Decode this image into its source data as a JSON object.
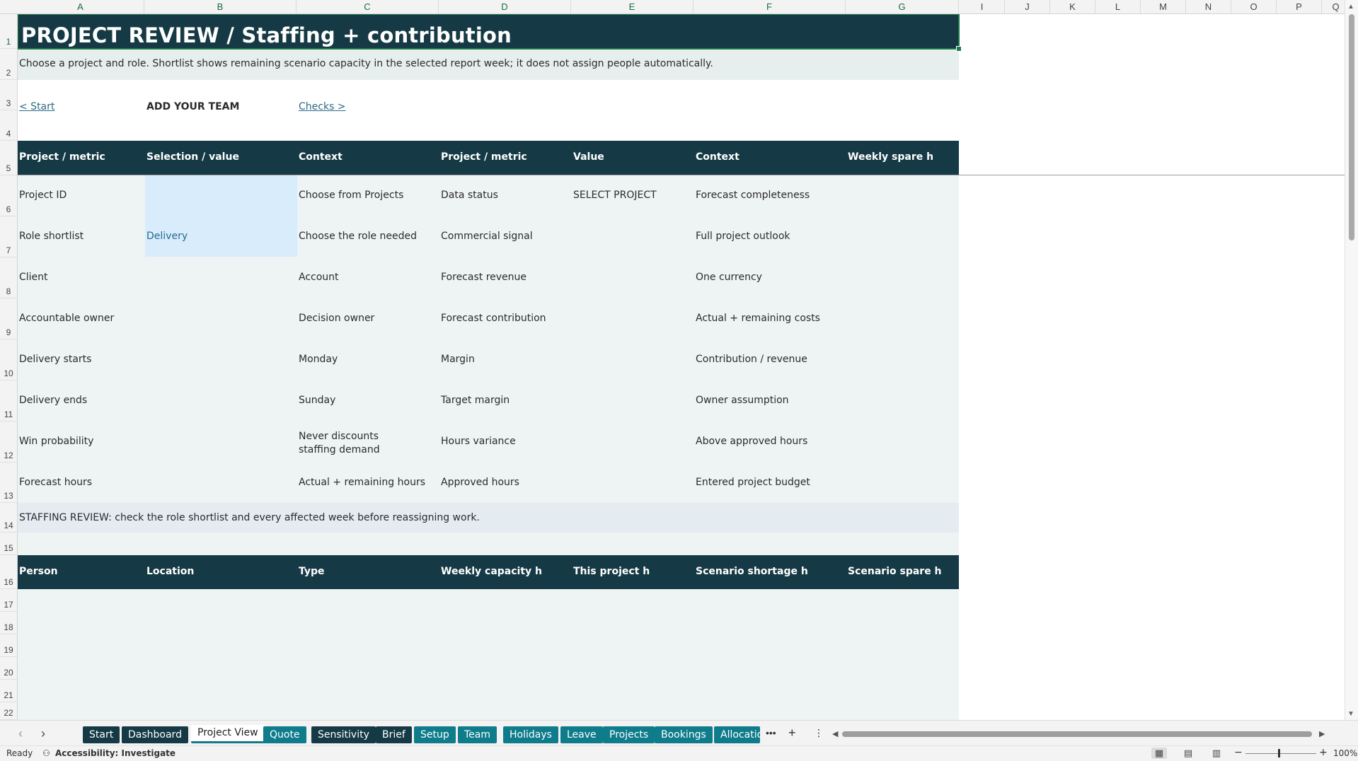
{
  "columns": [
    "A",
    "B",
    "C",
    "D",
    "E",
    "F",
    "G",
    "I",
    "J",
    "K",
    "L",
    "M",
    "N",
    "O",
    "P",
    "Q"
  ],
  "rows": [
    "1",
    "2",
    "3",
    "4",
    "5",
    "6",
    "7",
    "8",
    "9",
    "10",
    "11",
    "12",
    "13",
    "14",
    "15",
    "16",
    "17",
    "18",
    "19",
    "20",
    "21",
    "22"
  ],
  "title": "PROJECT REVIEW / Staffing + contribution",
  "note": "Choose a project and role. Shortlist shows remaining scenario capacity in the selected report week; it does not assign people automatically.",
  "nav": {
    "start": "< Start",
    "add_team": "ADD YOUR TEAM",
    "checks": "Checks >"
  },
  "project_header": [
    "Project / metric",
    "Selection / value",
    "Context",
    "Project / metric",
    "Value",
    "Context",
    "Weekly spare h"
  ],
  "project_rows": [
    [
      "Project ID",
      "",
      "Choose from Projects",
      "Data status",
      "SELECT PROJECT",
      "Forecast completeness"
    ],
    [
      "Role shortlist",
      "Delivery",
      "Choose the role needed",
      "Commercial signal",
      "",
      "Full project outlook"
    ],
    [
      "Client",
      "",
      "Account",
      "Forecast revenue",
      "",
      "One currency"
    ],
    [
      "Accountable owner",
      "",
      "Decision owner",
      "Forecast contribution",
      "",
      "Actual + remaining costs"
    ],
    [
      "Delivery starts",
      "",
      "Monday",
      "Margin",
      "",
      "Contribution / revenue"
    ],
    [
      "Delivery ends",
      "",
      "Sunday",
      "Target margin",
      "",
      "Owner assumption"
    ],
    [
      "Win probability",
      "",
      "Never discounts staffing demand",
      "Hours variance",
      "",
      "Above approved hours"
    ],
    [
      "Forecast hours",
      "",
      "Actual + remaining hours",
      "Approved hours",
      "",
      "Entered project budget"
    ]
  ],
  "staffing_review": "STAFFING REVIEW: check the role shortlist and every affected week before reassigning work.",
  "staff_header": [
    "Person",
    "Location",
    "Type",
    "Weekly capacity h",
    "This project h",
    "Scenario shortage h",
    "Scenario spare h"
  ],
  "tabs": [
    {
      "label": "Start",
      "style": "dark"
    },
    {
      "label": "Dashboard",
      "style": "dark"
    },
    {
      "label": "Project View",
      "style": "active"
    },
    {
      "label": "Quote",
      "style": "teal"
    },
    {
      "label": "Sensitivity",
      "style": "dark"
    },
    {
      "label": "Brief",
      "style": "dark"
    },
    {
      "label": "Setup",
      "style": "teal"
    },
    {
      "label": "Team",
      "style": "teal"
    },
    {
      "label": "Holidays",
      "style": "teal"
    },
    {
      "label": "Leave",
      "style": "teal"
    },
    {
      "label": "Projects",
      "style": "teal"
    },
    {
      "label": "Bookings",
      "style": "teal"
    },
    {
      "label": "Allocations",
      "style": "teal"
    }
  ],
  "status": {
    "ready": "Ready",
    "accessibility": "Accessibility: Investigate",
    "zoom": "100%"
  },
  "colors": {
    "dark": "#163a45",
    "teal": "#0f7c8c",
    "sheet_bg": "#eef3f3",
    "input": "#d9ecfb",
    "selection": "#1e7b4a"
  }
}
